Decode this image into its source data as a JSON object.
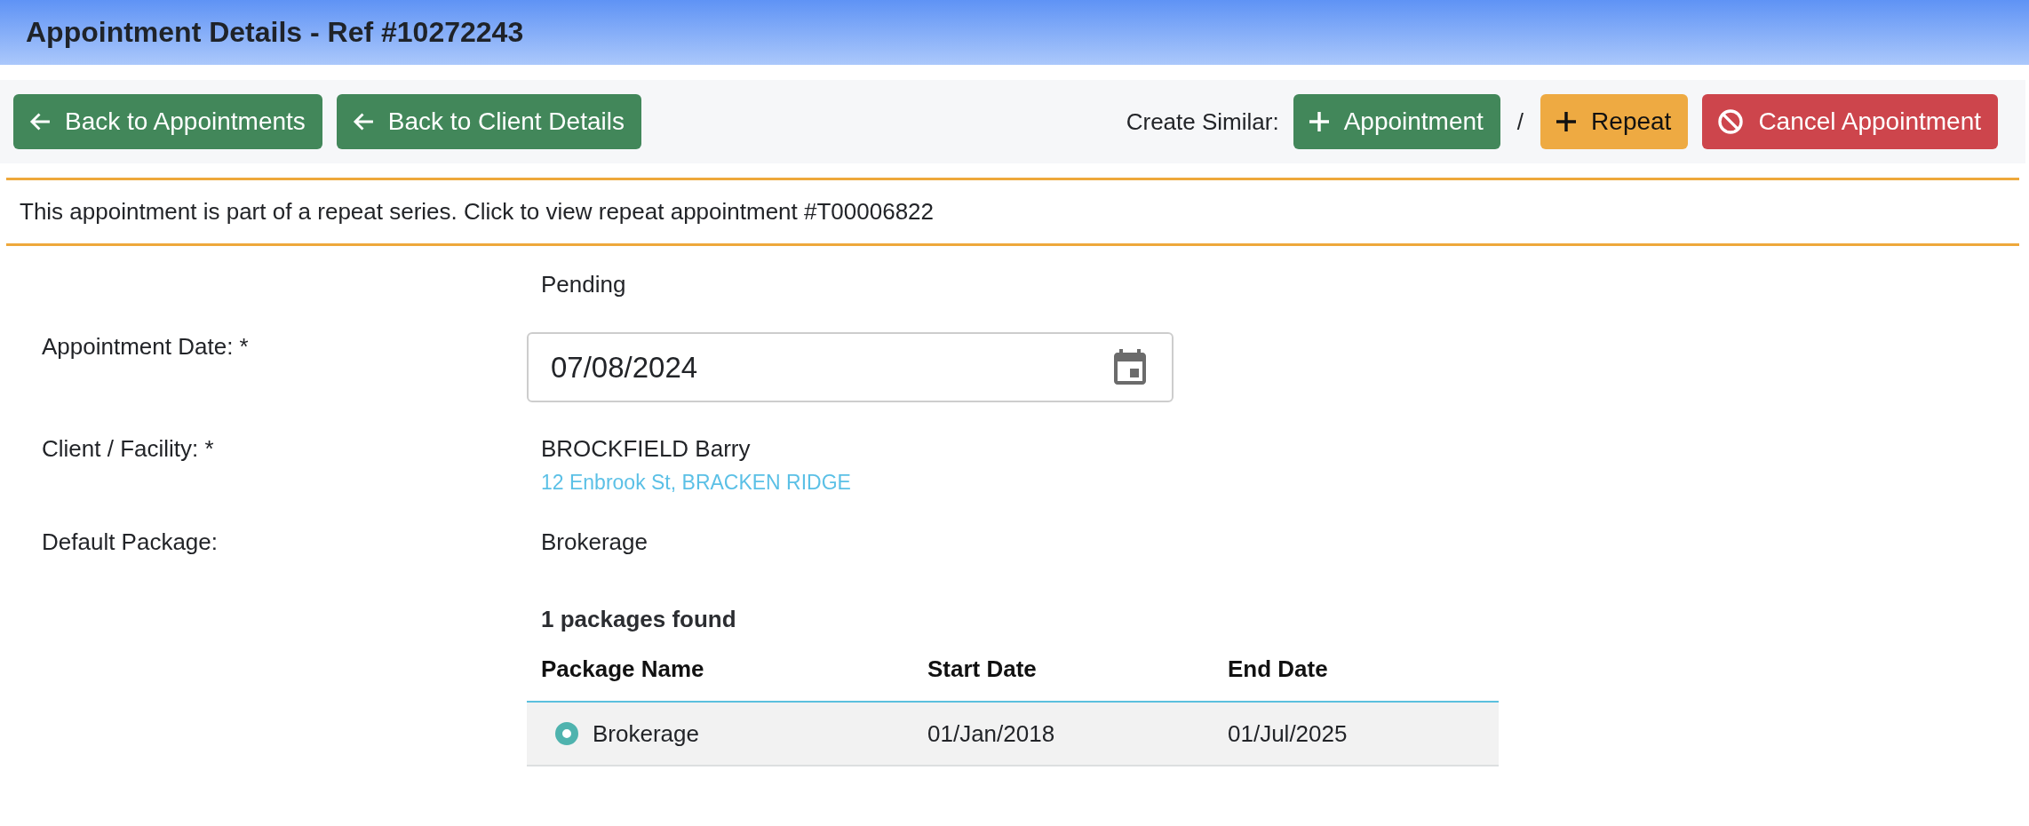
{
  "header": {
    "title": "Appointment Details - Ref #10272243"
  },
  "toolbar": {
    "back_buttons": [
      {
        "label": "Back to Appointments",
        "kind": "back"
      },
      {
        "label": "Back to Client Details",
        "kind": "back"
      }
    ],
    "create_similar": {
      "label": "Create Similar:",
      "separator": "/",
      "buttons": [
        {
          "label": "Appointment",
          "kind": "add"
        },
        {
          "label": "Repeat",
          "kind": "repeat"
        }
      ]
    },
    "cancel_button": {
      "label": "Cancel Appointment",
      "kind": "cancel"
    }
  },
  "notice": {
    "text": "This appointment is part of a repeat series. Click to view repeat appointment #T00006822"
  },
  "form": {
    "fields": [
      {
        "kind": "status",
        "value": "Pending"
      },
      {
        "kind": "date",
        "label": "Appointment Date: *",
        "value": "07/08/2024"
      },
      {
        "kind": "client",
        "label": "Client / Facility: *",
        "value": "BROCKFIELD Barry",
        "address": "12 Enbrook St, BRACKEN RIDGE"
      },
      {
        "kind": "text",
        "label": "Default Package:",
        "value": "Brokerage"
      }
    ]
  },
  "packages": {
    "summary": "1 packages found",
    "columns": [
      "Package Name",
      "Start Date",
      "End Date"
    ],
    "rows": [
      {
        "selected": true,
        "cells": [
          "Brokerage",
          "01/Jan/2018",
          "01/Jul/2025"
        ]
      }
    ]
  }
}
